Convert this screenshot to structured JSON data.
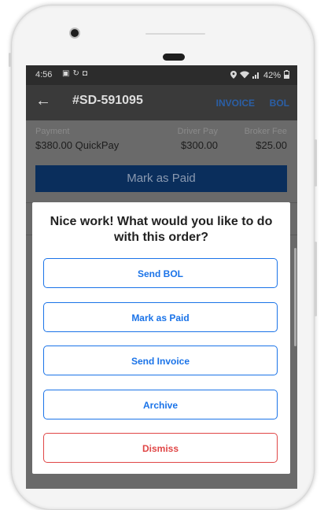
{
  "status_bar": {
    "time": "4:56",
    "left_icons": [
      "image-icon",
      "sync-icon",
      "app-icon"
    ],
    "battery": "42%",
    "right_icons": [
      "location-icon",
      "wifi-icon",
      "signal-icon",
      "battery-icon"
    ]
  },
  "app_bar": {
    "order_id": "#SD-591095",
    "actions": {
      "invoice": "INVOICE",
      "bol": "BOL"
    },
    "accent_color": "#2b5fa6"
  },
  "payment": {
    "payment_label": "Payment",
    "payment_value": "$380.00 QuickPay",
    "driver_pay_label": "Driver Pay",
    "driver_pay_value": "$300.00",
    "broker_fee_label": "Broker Fee",
    "broker_fee_value": "$25.00"
  },
  "mark_as_paid_bar": {
    "label": "Mark as Paid",
    "color": "#0a2e5c"
  },
  "dialog": {
    "heading": "Nice work! What would you like to do with this order?",
    "buttons": [
      {
        "label": "Send BOL",
        "color": "#1a73e8"
      },
      {
        "label": "Mark as Paid",
        "color": "#1a73e8"
      },
      {
        "label": "Send Invoice",
        "color": "#1a73e8"
      },
      {
        "label": "Archive",
        "color": "#1a73e8"
      },
      {
        "label": "Dismiss",
        "color": "#e04646"
      }
    ]
  }
}
